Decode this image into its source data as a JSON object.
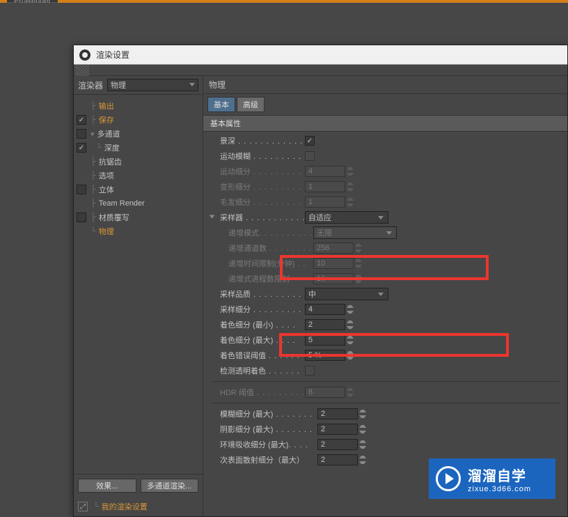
{
  "top_tab": "ProRender",
  "dialog_title": "渲染设置",
  "renderer_label": "渲染器",
  "renderer_value": "物理",
  "tree": {
    "output": "输出",
    "save": "保存",
    "multipass": "多通道",
    "depth": "深度",
    "antialias": "抗锯齿",
    "options": "选项",
    "stereo": "立体",
    "team_render": "Team Render",
    "material_override": "材质覆写",
    "physical": "物理"
  },
  "buttons": {
    "effects": "效果...",
    "multipass_render": "多通道渲染..."
  },
  "my_render_settings": "我的渲染设置",
  "right_title": "物理",
  "tabs": {
    "basic": "基本",
    "advanced": "高级"
  },
  "section_basic": "基本属性",
  "props": {
    "dof": "景深",
    "motion_blur": "运动模糊",
    "motion_subdiv": "运动细分",
    "motion_subdiv_val": "4",
    "deform_subdiv": "变形细分",
    "deform_subdiv_val": "1",
    "hair_subdiv": "毛发细分",
    "hair_subdiv_val": "1",
    "sampler": "采样器",
    "sampler_val": "自适应",
    "progressive_mode": "递增模式",
    "progressive_mode_val": "无限",
    "progressive_passes": "递增通道数",
    "progressive_passes_val": "256",
    "progressive_time": "递增时间限制(分钟)",
    "progressive_time_val": "10",
    "progressive_count": "递增式进程数限制",
    "progressive_count_val": "16",
    "sample_quality": "采样品质",
    "sample_quality_val": "中",
    "sample_subdiv": "采样细分",
    "sample_subdiv_val": "4",
    "shading_min": "着色细分 (最小)",
    "shading_min_val": "2",
    "shading_max": "着色细分 (最大)",
    "shading_max_val": "5",
    "shading_error": "着色错误阈值",
    "shading_error_val": "5 %",
    "detect_transparent": "检测透明着色",
    "hdr_threshold": "HDR 阈值",
    "hdr_threshold_val": "8",
    "blur_max": "模糊细分 (最大)",
    "blur_max_val": "2",
    "shadow_max": "阴影细分 (最大)",
    "shadow_max_val": "2",
    "ao_max": "环境吸收细分 (最大)",
    "ao_max_val": "2",
    "sss_max": "次表面散射细分（最大）",
    "sss_max_val": "2"
  },
  "watermark": {
    "title": "溜溜自学",
    "sub": "zixue.3d66.com"
  }
}
